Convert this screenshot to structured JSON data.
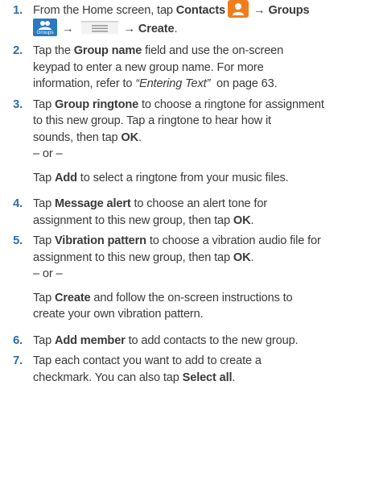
{
  "steps": [
    {
      "num": "1.",
      "t1": "From the Home screen, tap ",
      "b_contacts": "Contacts",
      "arrow1": "→",
      "b_groups": "Groups",
      "groups_icon_caption": "Groups",
      "arrow2": "→",
      "arrow3": "→",
      "b_create": "Create",
      "t_end": "."
    },
    {
      "num": "2.",
      "t1": "Tap the ",
      "b1": "Group name",
      "t2": " field and use the on-screen",
      "t3": "keypad to enter a new group name. For more",
      "t4": "information, refer to ",
      "i1": "“Entering Text”",
      "t5": "  on page 63."
    },
    {
      "num": "3.",
      "t1": "Tap ",
      "b1": "Group ringtone",
      "t2": " to choose a ringtone for assignment",
      "t3": "to this new group. Tap a ringtone to hear how it",
      "t4": "sounds, then tap ",
      "b2": "OK",
      "t5": ".",
      "or": "– or –",
      "alt1": "Tap ",
      "alt_b": "Add",
      "alt2": " to select a ringtone from your music files."
    },
    {
      "num": "4.",
      "t1": "Tap ",
      "b1": "Message alert",
      "t2": " to choose an alert tone for",
      "t3": "assignment to this new group, then tap ",
      "b2": "OK",
      "t4": "."
    },
    {
      "num": "5.",
      "t1": "Tap ",
      "b1": "Vibration pattern",
      "t2": " to choose a vibration audio file for",
      "t3": "assignment to this new group, then tap ",
      "b2": "OK",
      "t4": ".",
      "or": "– or –",
      "alt1": "Tap ",
      "alt_b": "Create",
      "alt2": " and follow the on-screen instructions to",
      "alt3": "create your own vibration pattern."
    },
    {
      "num": "6.",
      "t1": "Tap ",
      "b1": "Add member",
      "t2": " to add contacts to the new group."
    },
    {
      "num": "7.",
      "t1": "Tap each contact you want to add to create a",
      "t2": "checkmark. You can also tap ",
      "b1": "Select all",
      "t3": "."
    }
  ],
  "colors": {
    "number": "#2b6cb0",
    "contacts_icon": "#f07c1c",
    "groups_icon": "#2c79c2",
    "text": "#3a3a3a"
  },
  "icons": [
    "contacts-icon",
    "groups-icon",
    "menu-icon"
  ]
}
